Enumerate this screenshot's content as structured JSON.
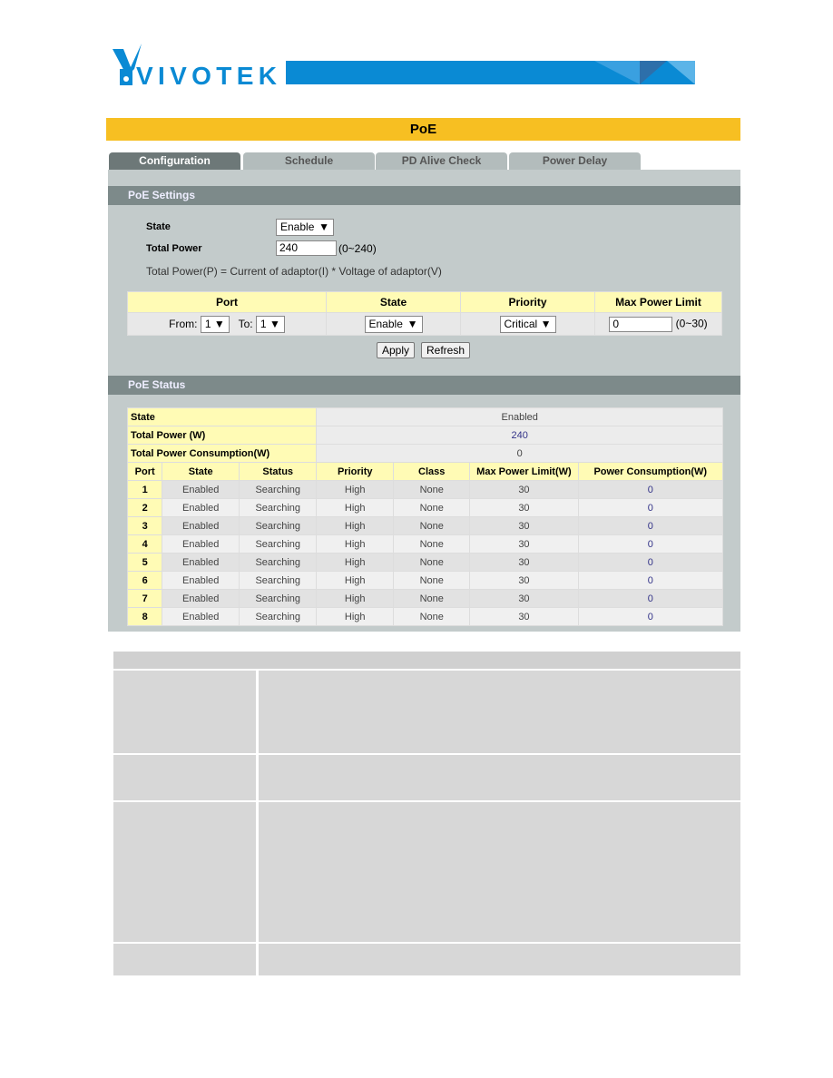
{
  "brand": {
    "name": "VIVOTEK",
    "color": "#0a8ad4"
  },
  "page_title": "PoE",
  "tabs": [
    {
      "label": "Configuration",
      "active": true
    },
    {
      "label": "Schedule"
    },
    {
      "label": "PD Alive Check"
    },
    {
      "label": "Power Delay"
    }
  ],
  "settings": {
    "header": "PoE Settings",
    "state_label": "State",
    "state_value": "Enable",
    "total_power_label": "Total Power",
    "total_power_value": "240",
    "total_power_range": "(0~240)",
    "formula": "Total Power(P) = Current of adaptor(I) * Voltage of adaptor(V)"
  },
  "port_config": {
    "headers": [
      "Port",
      "State",
      "Priority",
      "Max Power Limit"
    ],
    "from_label": "From:",
    "from_value": "1",
    "to_label": "To:",
    "to_value": "1",
    "state": "Enable",
    "priority": "Critical",
    "max_power": "0",
    "max_range": "(0~30)"
  },
  "buttons": {
    "apply": "Apply",
    "refresh": "Refresh"
  },
  "status": {
    "header": "PoE Status",
    "summary": [
      {
        "label": "State",
        "value": "Enabled"
      },
      {
        "label": "Total Power (W)",
        "value": "240"
      },
      {
        "label": "Total Power Consumption(W)",
        "value": "0"
      }
    ],
    "columns": [
      "Port",
      "State",
      "Status",
      "Priority",
      "Class",
      "Max Power Limit(W)",
      "Power Consumption(W)"
    ],
    "rows": [
      [
        "1",
        "Enabled",
        "Searching",
        "High",
        "None",
        "30",
        "0"
      ],
      [
        "2",
        "Enabled",
        "Searching",
        "High",
        "None",
        "30",
        "0"
      ],
      [
        "3",
        "Enabled",
        "Searching",
        "High",
        "None",
        "30",
        "0"
      ],
      [
        "4",
        "Enabled",
        "Searching",
        "High",
        "None",
        "30",
        "0"
      ],
      [
        "5",
        "Enabled",
        "Searching",
        "High",
        "None",
        "30",
        "0"
      ],
      [
        "6",
        "Enabled",
        "Searching",
        "High",
        "None",
        "30",
        "0"
      ],
      [
        "7",
        "Enabled",
        "Searching",
        "High",
        "None",
        "30",
        "0"
      ],
      [
        "8",
        "Enabled",
        "Searching",
        "High",
        "None",
        "30",
        "0"
      ]
    ]
  }
}
